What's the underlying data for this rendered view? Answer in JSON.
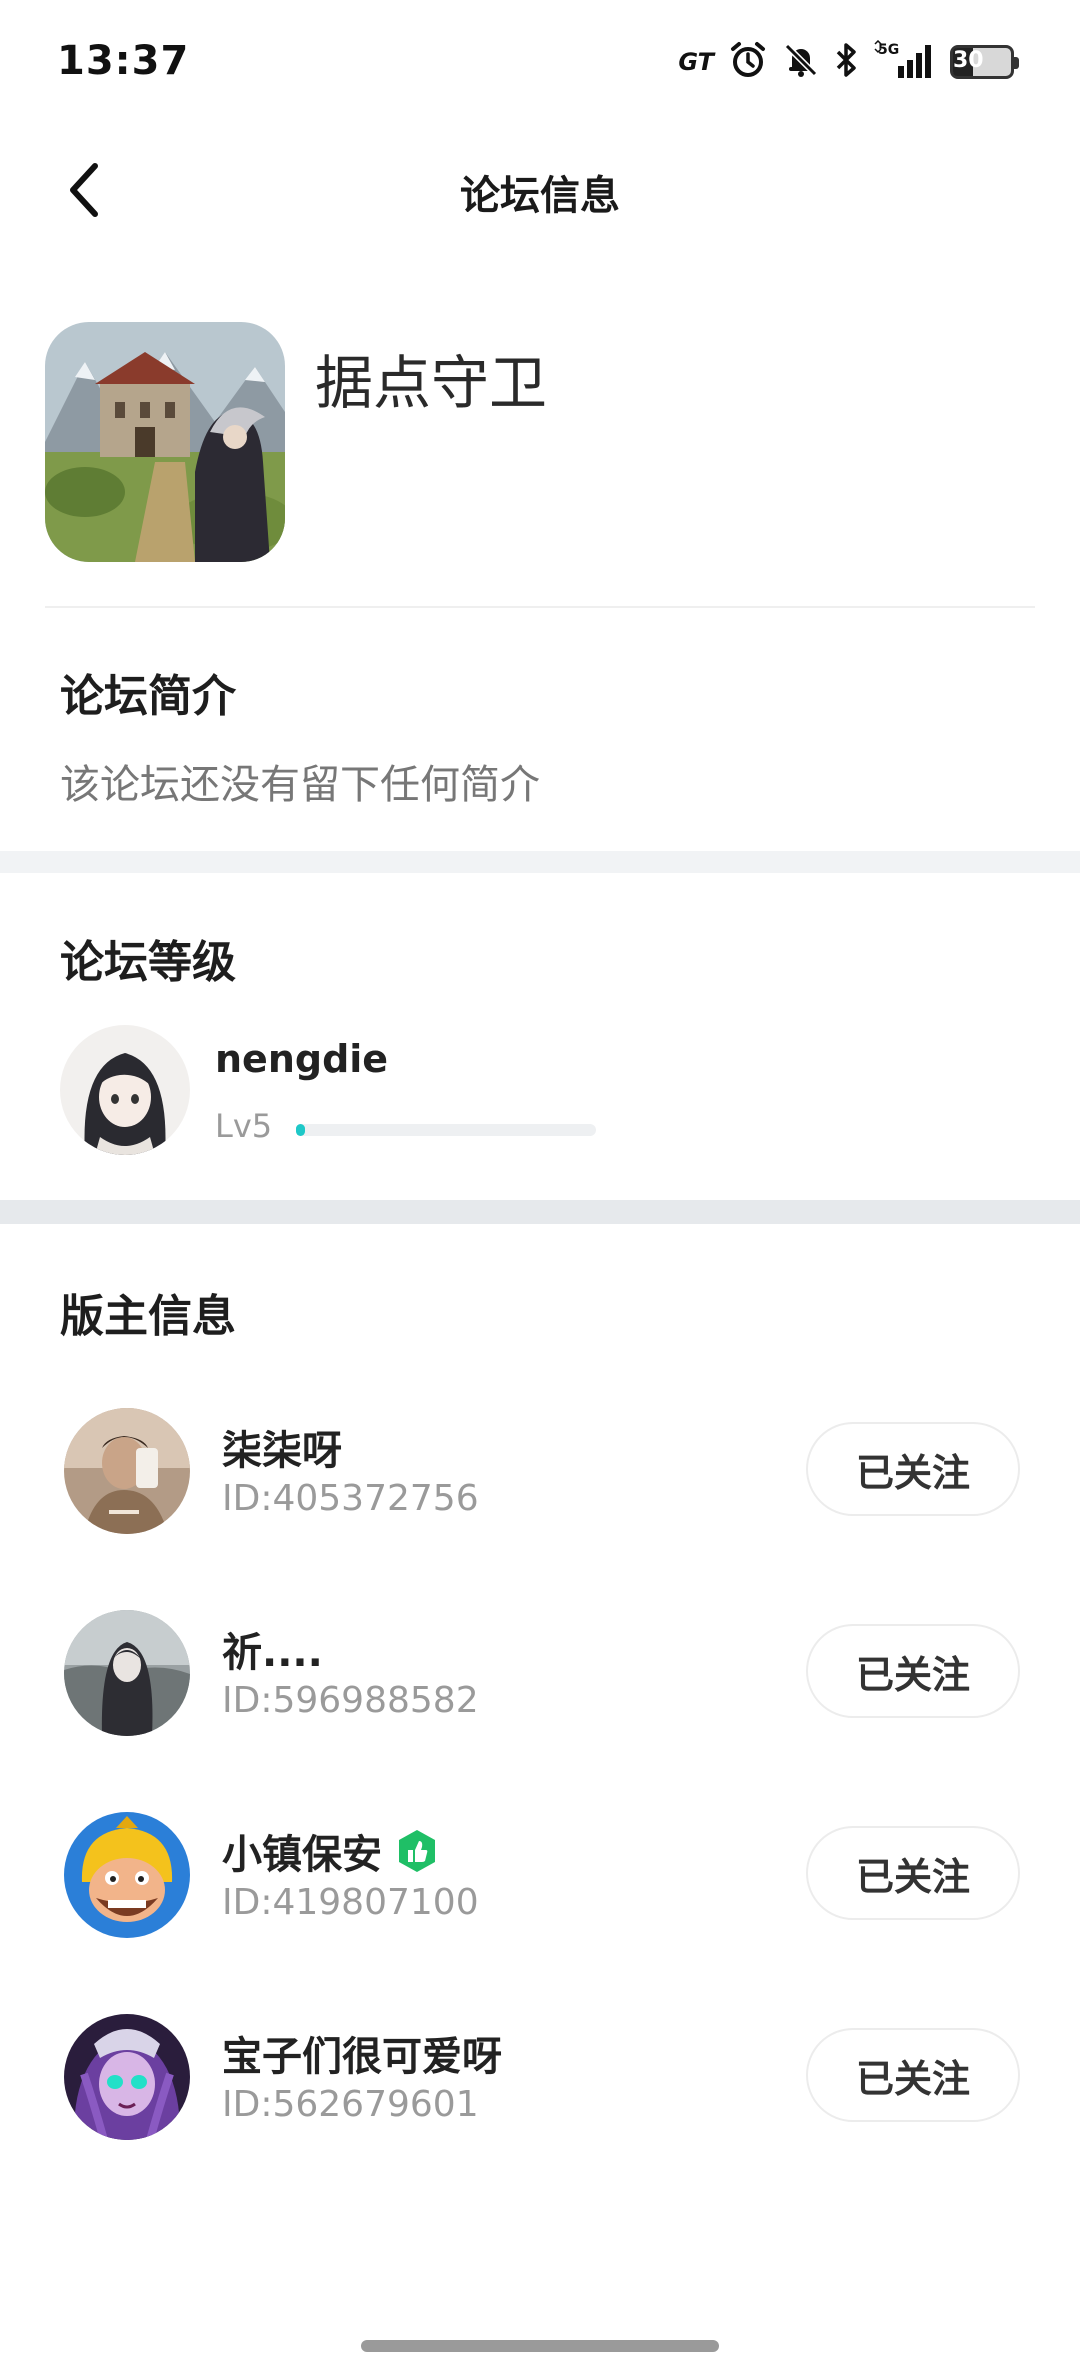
{
  "status_bar": {
    "time": "13:37",
    "carrier_badge": "GT",
    "network": "5G",
    "battery": "30",
    "icons": [
      "gt-mode-icon",
      "alarm-icon",
      "mute-bell-icon",
      "bluetooth-icon",
      "signal-5g-icon",
      "battery-icon"
    ]
  },
  "nav": {
    "title": "论坛信息",
    "back_icon": "chevron-left-icon"
  },
  "forum": {
    "name": "据点守卫"
  },
  "intro": {
    "title": "论坛简介",
    "text": "该论坛还没有留下任何简介"
  },
  "level": {
    "title": "论坛等级",
    "user_name": "nengdie",
    "level_label": "Lv5",
    "progress": 0.02,
    "progress_color": "#1ec8c8"
  },
  "moderators": {
    "title": "版主信息",
    "items": [
      {
        "name": "柒柒呀",
        "id": "ID:405372756",
        "button": "已关注",
        "badge": false
      },
      {
        "name": "祈....",
        "id": "ID:596988582",
        "button": "已关注",
        "badge": false
      },
      {
        "name": "小镇保安",
        "id": "ID:419807100",
        "button": "已关注",
        "badge": true
      },
      {
        "name": "宝子们很可爱呀",
        "id": "ID:562679601",
        "button": "已关注",
        "badge": false
      }
    ]
  }
}
